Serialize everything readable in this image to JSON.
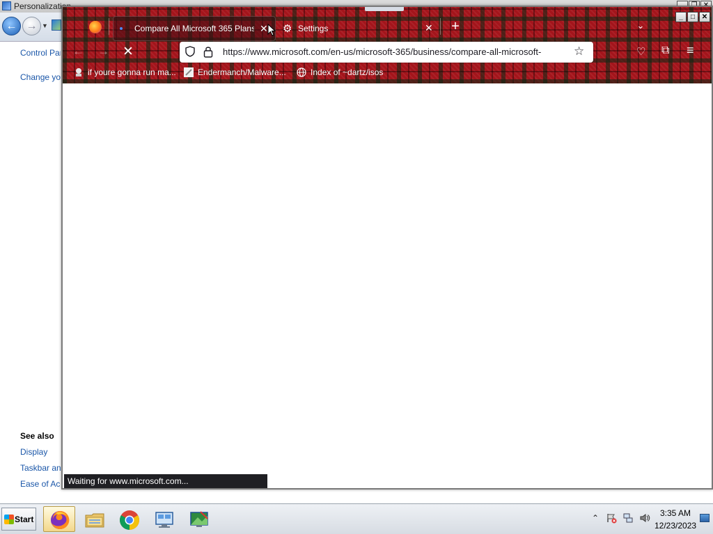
{
  "control_panel": {
    "title": "Personalization",
    "links": {
      "home": "Control Par",
      "change": "Change yo",
      "display": "Display",
      "taskbar": "Taskbar an",
      "ease": "Ease of Acc"
    },
    "see_also": "See also"
  },
  "firefox": {
    "tabs": [
      {
        "label": "Compare All Microsoft 365 Plans",
        "active": true
      },
      {
        "label": "Settings",
        "active": false
      }
    ],
    "url": "https://www.microsoft.com/en-us/microsoft-365/business/compare-all-microsoft-",
    "bookmarks": [
      {
        "label": "if youre gonna run ma..."
      },
      {
        "label": "Endermanch/Malware..."
      },
      {
        "label": "Index of ~dartz/isos"
      }
    ],
    "status": "Waiting for www.microsoft.com..."
  },
  "taskbar": {
    "start_label": "Start",
    "apps": [
      "firefox",
      "file-explorer",
      "chrome",
      "remote-desktop",
      "control-panel"
    ],
    "time": "3:35 AM",
    "date": "12/23/2023"
  },
  "colors": {
    "tartan_base": "#a4141b",
    "link": "#1a56a8",
    "status_bg": "#1f1f23"
  }
}
